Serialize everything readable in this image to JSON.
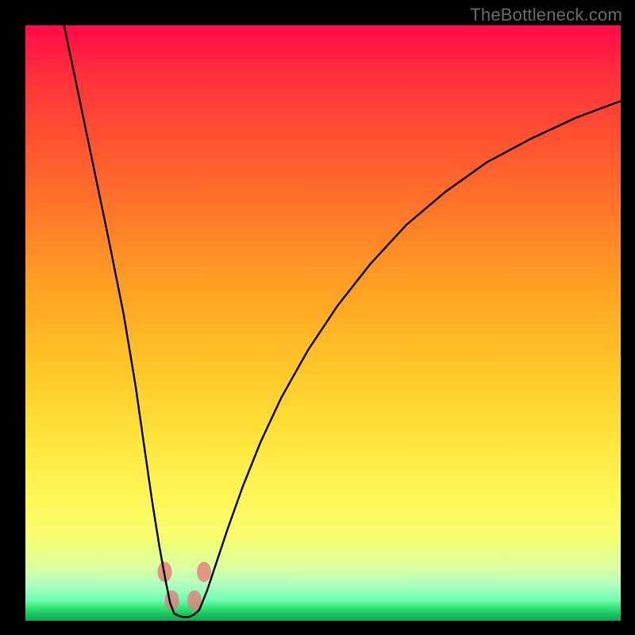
{
  "watermark": {
    "text": "TheBottleneck.com"
  },
  "colors": {
    "gradient_top": "#ff0a4a",
    "gradient_bottom": "#10a856",
    "curve_stroke": "#000000",
    "bead": "#e47a78",
    "frame": "#000000"
  },
  "chart_data": {
    "type": "line",
    "title": "",
    "xlabel": "",
    "ylabel": "",
    "x_range": [
      0,
      1
    ],
    "y_range": [
      0,
      1
    ],
    "note": "x and y are normalized to plot area; y=0 at bottom (green), y=1 at top (red). Two curve branches meeting at a narrow U near x≈0.25, y≈0. Background gradient maps vertical position to a bottleneck-severity scale: green=low, red=high.",
    "series": [
      {
        "name": "left-branch",
        "x": [
          0.065,
          0.09,
          0.115,
          0.14,
          0.165,
          0.185,
          0.2,
          0.213,
          0.225,
          0.235,
          0.243,
          0.25
        ],
        "y": [
          1.0,
          0.88,
          0.76,
          0.64,
          0.515,
          0.395,
          0.29,
          0.2,
          0.125,
          0.07,
          0.03,
          0.012
        ]
      },
      {
        "name": "valley",
        "x": [
          0.25,
          0.258,
          0.266,
          0.274,
          0.283,
          0.292
        ],
        "y": [
          0.012,
          0.008,
          0.006,
          0.006,
          0.01,
          0.018
        ]
      },
      {
        "name": "right-branch",
        "x": [
          0.292,
          0.305,
          0.32,
          0.34,
          0.365,
          0.395,
          0.43,
          0.475,
          0.525,
          0.58,
          0.64,
          0.705,
          0.775,
          0.85,
          0.925,
          1.0
        ],
        "y": [
          0.018,
          0.05,
          0.095,
          0.155,
          0.225,
          0.3,
          0.375,
          0.455,
          0.53,
          0.6,
          0.665,
          0.72,
          0.77,
          0.81,
          0.845,
          0.873
        ]
      }
    ],
    "beads": {
      "note": "Small rounded markers near the valley bottom on both sides of the U.",
      "points": [
        {
          "x": 0.234,
          "y": 0.082
        },
        {
          "x": 0.246,
          "y": 0.034
        },
        {
          "x": 0.284,
          "y": 0.034
        },
        {
          "x": 0.3,
          "y": 0.082
        }
      ],
      "rx": 0.012,
      "ry": 0.017
    }
  }
}
